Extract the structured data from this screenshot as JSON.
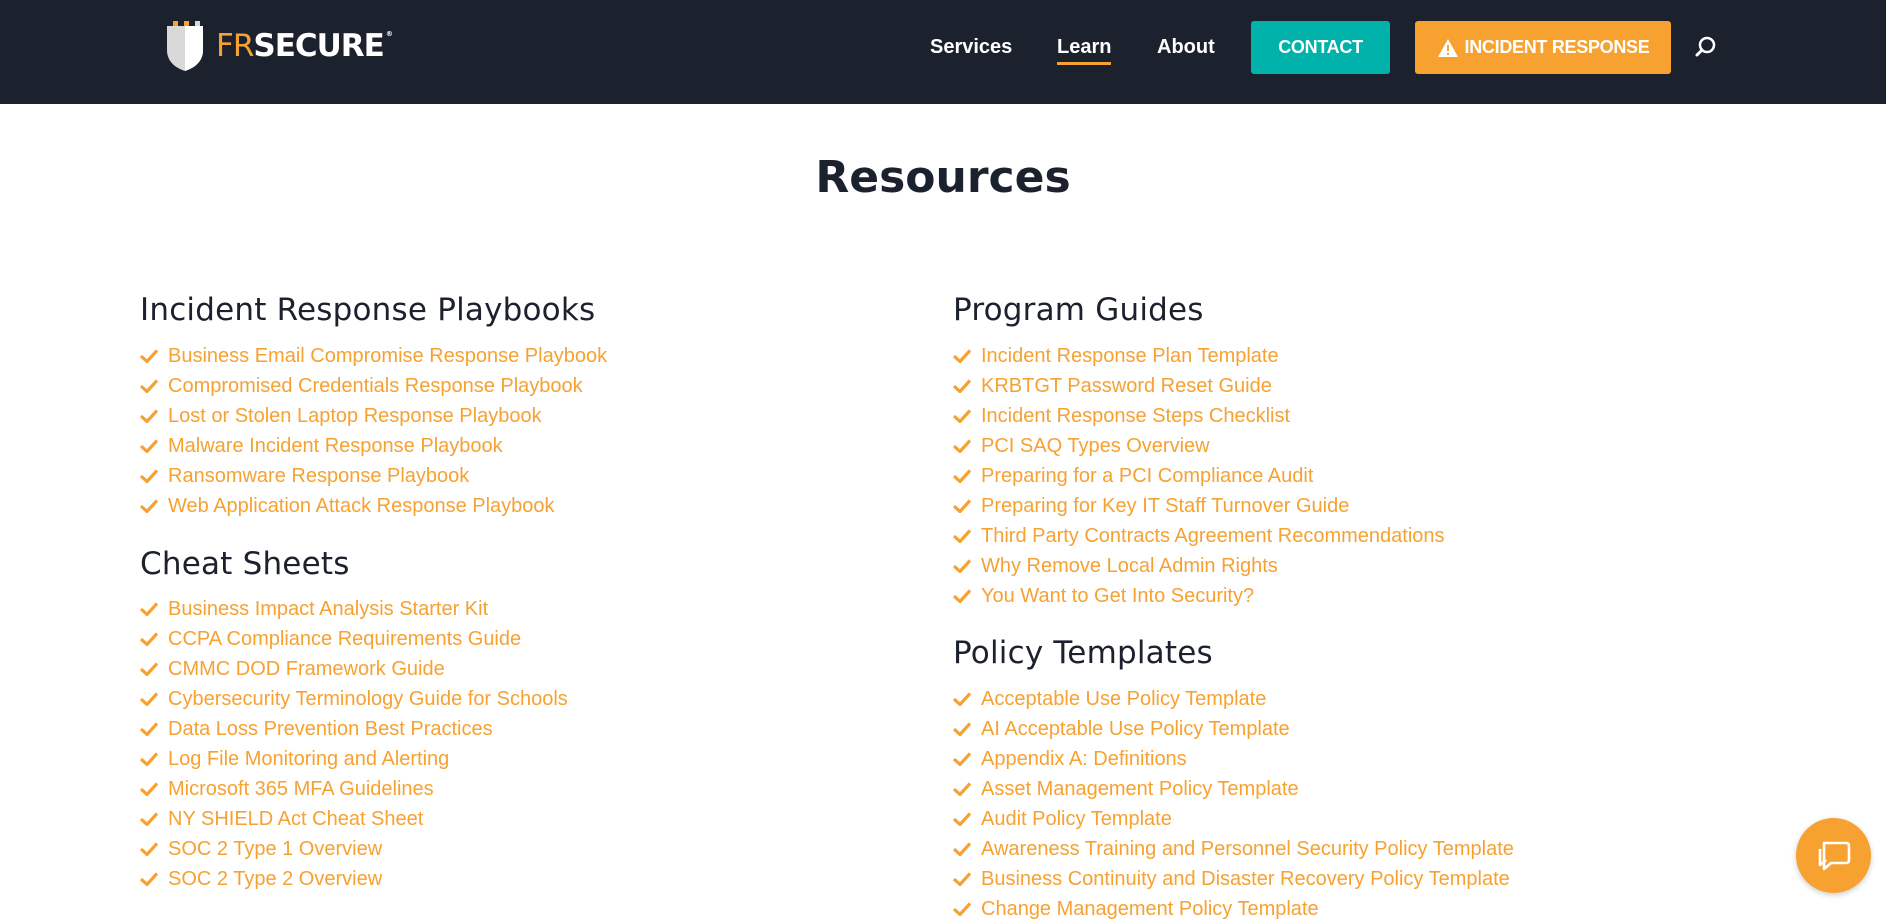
{
  "brand": {
    "fr": "FR",
    "secure": "SECURE",
    "tm": "®"
  },
  "nav": {
    "services": "Services",
    "learn": "Learn",
    "about": "About",
    "contact": "CONTACT",
    "incident": "INCIDENT RESPONSE"
  },
  "page_title": "Resources",
  "sections": {
    "playbooks": {
      "title": "Incident Response Playbooks",
      "items": [
        "Business Email Compromise Response Playbook",
        "Compromised Credentials Response Playbook",
        "Lost or Stolen Laptop Response Playbook",
        "Malware Incident Response Playbook",
        "Ransomware Response Playbook",
        "Web Application Attack Response Playbook"
      ]
    },
    "cheat_sheets": {
      "title": "Cheat Sheets",
      "items": [
        "Business Impact Analysis Starter Kit",
        "CCPA Compliance Requirements Guide",
        "CMMC DOD Framework Guide",
        "Cybersecurity Terminology Guide for Schools",
        "Data Loss Prevention Best Practices",
        "Log File Monitoring and Alerting",
        "Microsoft 365 MFA Guidelines",
        "NY SHIELD Act Cheat Sheet",
        "SOC 2 Type 1 Overview",
        "SOC 2 Type 2 Overview"
      ]
    },
    "program_guides": {
      "title": "Program Guides",
      "items": [
        "Incident Response Plan Template",
        "KRBTGT Password Reset Guide",
        "Incident Response Steps Checklist",
        "PCI SAQ Types Overview",
        "Preparing for a PCI Compliance Audit",
        "Preparing for Key IT Staff Turnover Guide",
        "Third Party Contracts Agreement Recommendations",
        "Why Remove Local Admin Rights",
        "You Want to Get Into Security?"
      ]
    },
    "policy_templates": {
      "title": "Policy Templates",
      "items": [
        "Acceptable Use Policy Template",
        "AI Acceptable Use Policy Template",
        "Appendix A: Definitions",
        "Asset Management Policy Template",
        "Audit Policy Template",
        "Awareness Training and Personnel Security Policy Template",
        "Business Continuity and Disaster Recovery Policy Template",
        "Change Management Policy Template"
      ]
    }
  },
  "colors": {
    "header_bg": "#1c212e",
    "accent_orange": "#f7a131",
    "contact_teal": "#00b2a9",
    "heading": "#1c212e"
  },
  "icons": [
    "shield-logo-icon",
    "warning-icon",
    "search-icon",
    "check-icon",
    "chat-icon"
  ]
}
